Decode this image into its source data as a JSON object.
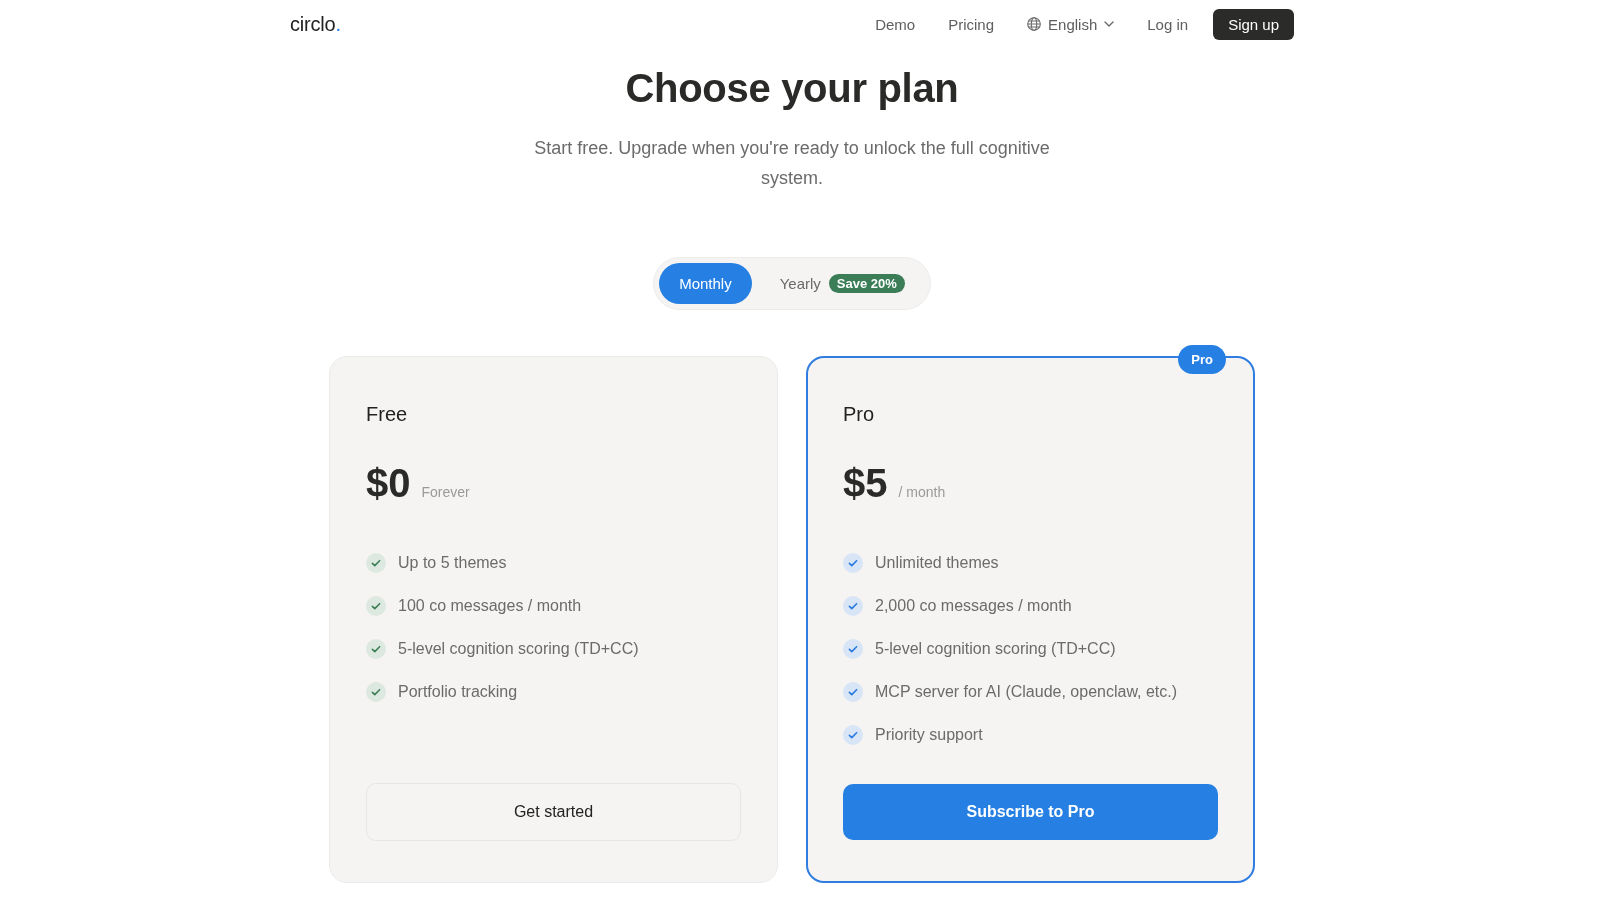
{
  "nav": {
    "logo": {
      "text": "circlo",
      "accent": "."
    },
    "links": [
      {
        "label": "Demo"
      },
      {
        "label": "Pricing"
      }
    ],
    "language": {
      "label": "English"
    },
    "login": "Log in",
    "signup": "Sign up"
  },
  "hero": {
    "title": "Choose your plan",
    "subtitle": "Start free. Upgrade when you're ready to unlock the full cognitive system."
  },
  "billing_toggle": {
    "options": [
      {
        "label": "Monthly",
        "selected": true
      },
      {
        "label": "Yearly",
        "selected": false,
        "badge": "Save 20%"
      }
    ]
  },
  "plans": [
    {
      "name": "Free",
      "price": "$0",
      "period": "Forever",
      "featured": false,
      "features": [
        "Up to 5 themes",
        "100 co messages / month",
        "5-level cognition scoring (TD+CC)",
        "Portfolio tracking"
      ],
      "button": "Get started"
    },
    {
      "name": "Pro",
      "badge": "Pro",
      "price": "$5",
      "period": "/ month",
      "featured": true,
      "features": [
        "Unlimited themes",
        "2,000 co messages / month",
        "5-level cognition scoring (TD+CC)",
        "MCP server for AI (Claude, openclaw, etc.)",
        "Priority support"
      ],
      "button": "Subscribe to Pro"
    }
  ]
}
